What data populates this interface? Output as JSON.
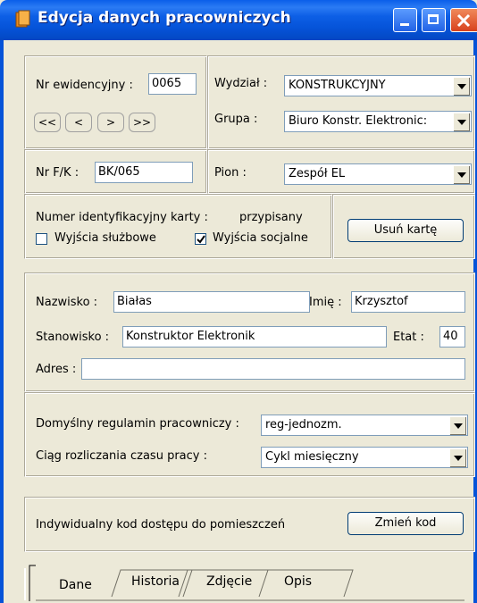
{
  "window": {
    "title": "Edycja danych pracowniczych"
  },
  "record": {
    "nr_label": "Nr ewidencyjny :",
    "nr_value": "0065",
    "nav": [
      "<<",
      "<",
      ">",
      ">>"
    ],
    "fk_label": "Nr F/K :",
    "fk_value": "BK/065"
  },
  "org": {
    "wydzial_label": "Wydział :",
    "wydzial_value": "KONSTRUKCYJNY",
    "grupa_label": "Grupa :",
    "grupa_value": "Biuro Konstr. Elektronic:",
    "pion_label": "Pion :",
    "pion_value": "Zespół EL"
  },
  "card": {
    "id_label": "Numer identyfikacyjny karty :",
    "id_status": "przypisany",
    "chk1_label": "Wyjścia służbowe",
    "chk1_checked": false,
    "chk2_label": "Wyjścia socjalne",
    "chk2_checked": true,
    "remove_button": "Usuń kartę"
  },
  "person": {
    "surname_label": "Nazwisko :",
    "surname_value": "Białas",
    "name_label": "Imię :",
    "name_value": "Krzysztof",
    "position_label": "Stanowisko :",
    "position_value": "Konstruktor Elektronik",
    "etat_label": "Etat :",
    "etat_value": "40",
    "address_label": "Adres :",
    "address_value": ""
  },
  "rules": {
    "regulamin_label": "Domyślny regulamin pracowniczy :",
    "regulamin_value": "reg-jednozm.",
    "ciag_label": "Ciąg rozliczania czasu pracy :",
    "ciag_value": "Cykl miesięczny"
  },
  "access": {
    "label": "Indywidualny kod dostępu do pomieszczeń",
    "button": "Zmień kod"
  },
  "tabs": [
    "Dane",
    "Historia",
    "Zdjęcie",
    "Opis"
  ],
  "colors": {
    "titlebar": "#0553d8",
    "face": "#ece9d8",
    "close": "#d8421d"
  }
}
